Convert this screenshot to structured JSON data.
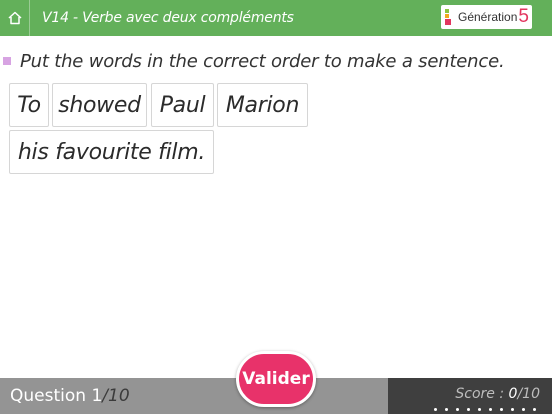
{
  "header": {
    "title": "V14 - Verbe avec deux compléments",
    "home_icon": "home-icon",
    "background_color": "#63b05a",
    "logo": {
      "text": "Génération",
      "number": "5",
      "number_color": "#e2365f"
    }
  },
  "exercise": {
    "instruction": "Put the words in the correct order to make a sentence.",
    "bullet_color": "#d7a3e2",
    "words": [
      "To",
      "showed",
      "Paul",
      "Marion",
      "his favourite film."
    ]
  },
  "footer": {
    "question_label": "Question",
    "question_current": "1",
    "question_total": "/10",
    "score_label": "Score : ",
    "score_value": "0",
    "score_total": "/10",
    "validate_label": "Valider",
    "validate_color": "#e8326a"
  }
}
